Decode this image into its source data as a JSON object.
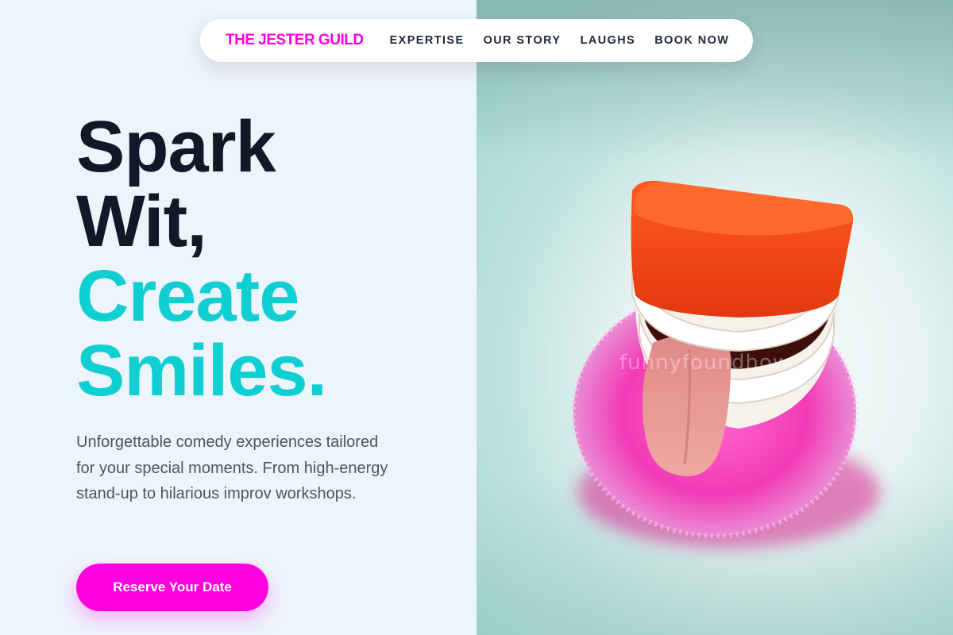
{
  "nav": {
    "brand": "THE JESTER GUILD",
    "links": [
      "EXPERTISE",
      "OUR STORY",
      "LAUGHS",
      "BOOK NOW"
    ]
  },
  "hero": {
    "headline_line1": "Spark",
    "headline_line2": "Wit,",
    "headline_line3": "Create",
    "headline_line4": "Smiles.",
    "description": "Unforgettable comedy experiences tailored for your special moments. From high-energy stand-up to hilarious improv workshops.",
    "cta_label": "Reserve Your Date"
  },
  "image": {
    "subject": "chattering-teeth-toy-icon",
    "watermark": "funnyfoundhow"
  },
  "colors": {
    "brand": "#ff00e1",
    "accent": "#0fcfd2",
    "headline_dark": "#111827",
    "body_text": "#4b5563",
    "left_bg": "#eef4fb"
  }
}
